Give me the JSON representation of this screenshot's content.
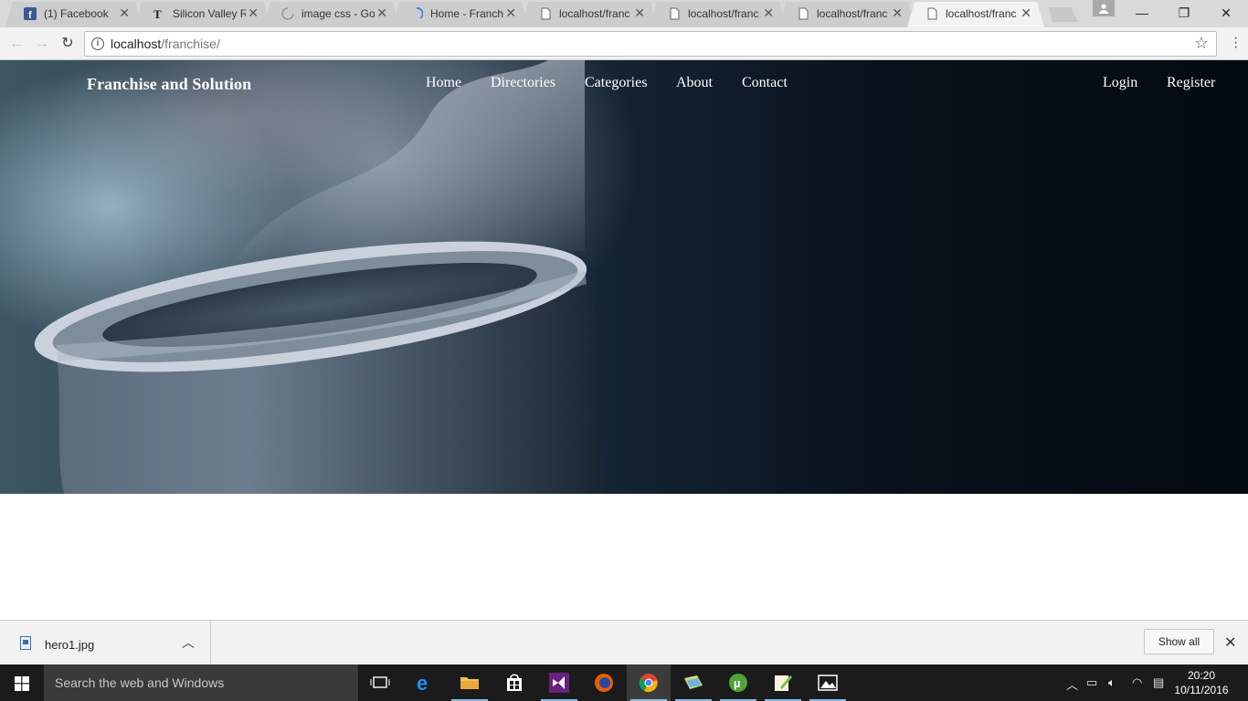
{
  "browser": {
    "tabs": [
      {
        "title": "(1) Facebook",
        "icon": "facebook-icon",
        "active": false
      },
      {
        "title": "Silicon Valley R",
        "icon": "nytimes-icon",
        "active": false
      },
      {
        "title": "image css - Go",
        "icon": "loading-spinner-icon",
        "active": false
      },
      {
        "title": "Home - Franch",
        "icon": "loading-spinner-icon",
        "active": false
      },
      {
        "title": "localhost/franc",
        "icon": "page-icon",
        "active": false
      },
      {
        "title": "localhost/franc",
        "icon": "page-icon",
        "active": false
      },
      {
        "title": "localhost/franc",
        "icon": "page-icon",
        "active": false
      },
      {
        "title": "localhost/franc",
        "icon": "page-icon",
        "active": true
      }
    ],
    "address": {
      "host": "localhost",
      "path": "/franchise/"
    }
  },
  "site": {
    "brand": "Franchise and Solution",
    "nav": {
      "home": "Home",
      "directories": "Directories",
      "categories": "Categories",
      "about": "About",
      "contact": "Contact"
    },
    "auth": {
      "login": "Login",
      "register": "Register"
    }
  },
  "downloads": {
    "file_name": "hero1.jpg",
    "show_all": "Show all"
  },
  "taskbar": {
    "search_placeholder": "Search the web and Windows",
    "time": "20:20",
    "date": "10/11/2016"
  },
  "colors": {
    "tabstrip": "#d9d9d9",
    "toolbar": "#f2f2f2",
    "taskbar": "#1b1b1b",
    "hero_dark": "#040a12"
  }
}
